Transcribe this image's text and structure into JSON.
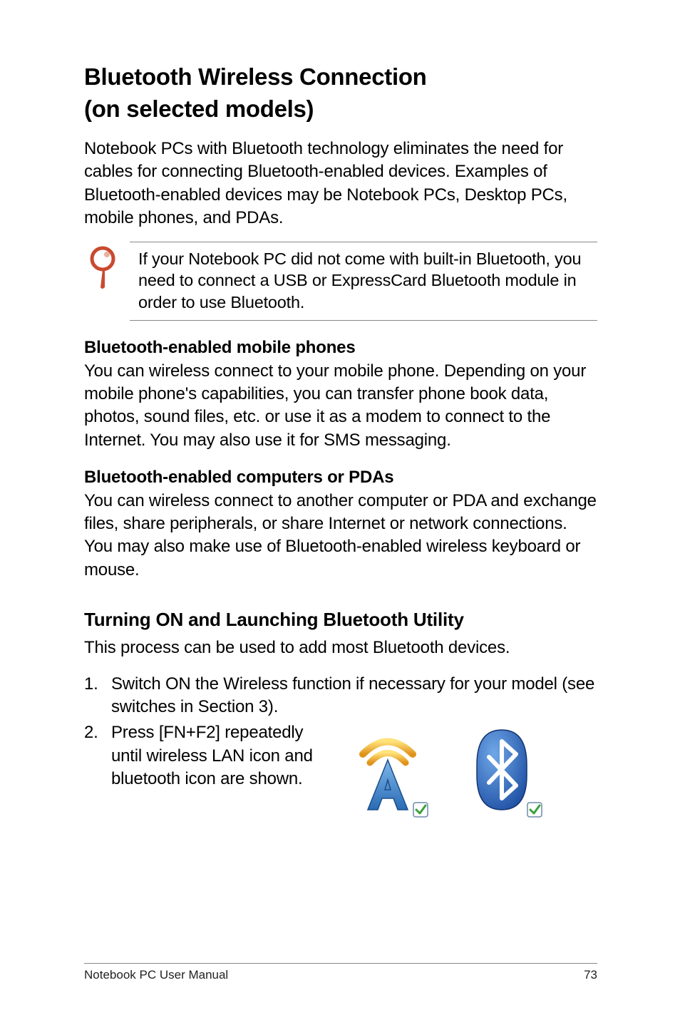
{
  "heading": {
    "line1": "Bluetooth Wireless Connection",
    "line2": "(on selected models)"
  },
  "intro_para": "Notebook PCs with Bluetooth technology eliminates the need for cables for connecting Bluetooth-enabled devices. Examples of Bluetooth-enabled devices may be Notebook PCs, Desktop PCs, mobile phones, and PDAs.",
  "note": "If your Notebook PC did not come with built-in Bluetooth, you need to connect a USB or ExpressCard Bluetooth module in order to use Bluetooth.",
  "sections": [
    {
      "title": "Bluetooth-enabled mobile phones",
      "body": "You can wireless connect to your mobile phone. Depending on your mobile phone's capabilities, you can transfer phone book data, photos, sound files, etc. or use it as a modem to connect to the Internet. You may also use it for SMS messaging."
    },
    {
      "title": "Bluetooth-enabled computers or PDAs",
      "body": "You can wireless connect to another computer or PDA and exchange files, share peripherals, or share Internet or network connections. You may also make use of Bluetooth-enabled wireless keyboard or mouse."
    }
  ],
  "utility": {
    "heading": "Turning ON and Launching Bluetooth Utility",
    "intro": "This process can be used to add most Bluetooth devices.",
    "steps": [
      {
        "num": "1.",
        "text": "Switch ON the Wireless function if necessary for your model (see switches in Section 3)."
      },
      {
        "num": "2.",
        "text": "Press [FN+F2] repeatedly until wireless LAN icon and bluetooth icon are shown."
      }
    ]
  },
  "icons": {
    "note_icon": "magnifier-pin-icon",
    "wifi_icon": "wireless-lan-icon",
    "bt_icon": "bluetooth-icon"
  },
  "footer": {
    "left": "Notebook PC User Manual",
    "right": "73"
  }
}
